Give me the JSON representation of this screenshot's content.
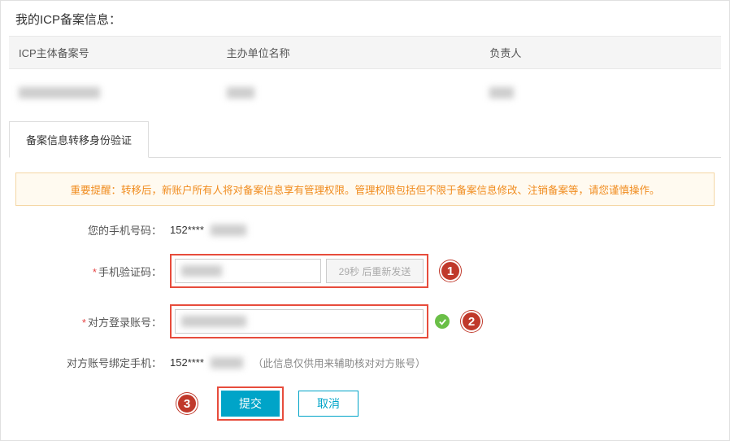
{
  "section_title": "我的ICP备案信息：",
  "table": {
    "headers": [
      "ICP主体备案号",
      "主办单位名称",
      "负责人"
    ]
  },
  "tab": {
    "label": "备案信息转移身份验证"
  },
  "notice": "重要提醒：转移后，新账户所有人将对备案信息享有管理权限。管理权限包括但不限于备案信息修改、注销备案等，请您谨慎操作。",
  "form": {
    "phone_label": "您的手机号码：",
    "phone_prefix": "152****",
    "code_label": "手机验证码：",
    "resend_label": "29秒 后重新发送",
    "account_label": "对方登录账号：",
    "bound_label": "对方账号绑定手机：",
    "bound_prefix": "152****",
    "bound_hint": "（此信息仅供用来辅助核对对方账号）",
    "submit": "提交",
    "cancel": "取消",
    "required_mark": "*"
  },
  "annotations": {
    "a1": "1",
    "a2": "2",
    "a3": "3"
  }
}
